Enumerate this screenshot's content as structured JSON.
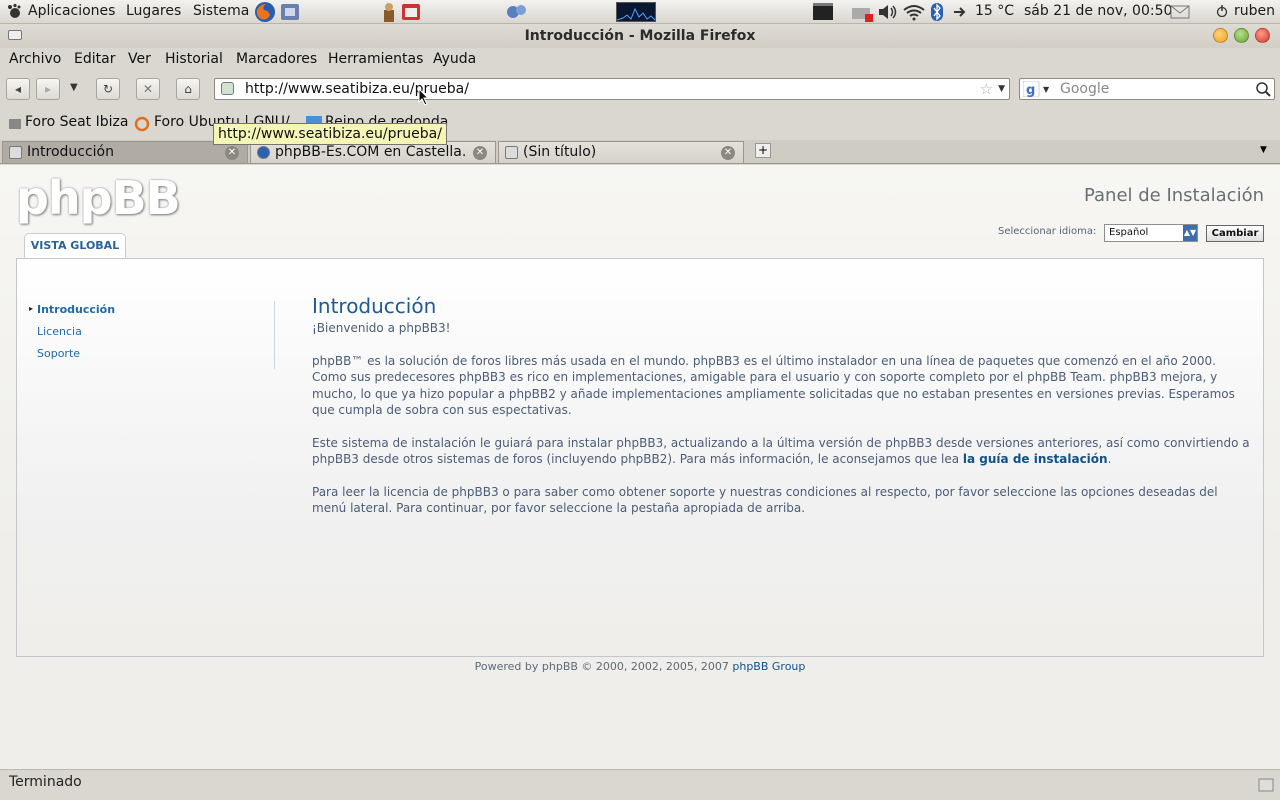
{
  "top_panel": {
    "applications": "Aplicaciones",
    "places": "Lugares",
    "system": "Sistema",
    "temperature": "15 °C",
    "datetime": "sáb 21 de nov, 00:50",
    "user": "ruben"
  },
  "window": {
    "title": "Introducción - Mozilla Firefox"
  },
  "menubar": [
    "Archivo",
    "Editar",
    "Ver",
    "Historial",
    "Marcadores",
    "Herramientas",
    "Ayuda"
  ],
  "navbar": {
    "url": "http://www.seatibiza.eu/prueba/",
    "search_placeholder": "Google"
  },
  "bookmarks": [
    "Foro Seat Ibiza",
    "Foro Ubuntu | GNU/",
    "Reino de redonda"
  ],
  "tooltip": "http://www.seatibiza.eu/prueba/",
  "tabs": [
    {
      "label": "Introducción",
      "active": true
    },
    {
      "label": "phpBB-Es.COM en Castella...",
      "active": false
    },
    {
      "label": "(Sin título)",
      "active": false
    }
  ],
  "page": {
    "logo": "phpBB",
    "panel_title": "Panel de Instalación",
    "lang_label": "Seleccionar idioma:",
    "lang_value": "Español",
    "change_button": "Cambiar",
    "tab_label": "VISTA GLOBAL",
    "sidenav": [
      "Introducción",
      "Licencia",
      "Soporte"
    ],
    "heading": "Introducción",
    "welcome": "¡Bienvenido a phpBB3!",
    "para1": "phpBB™ es la solución de foros libres más usada en el mundo. phpBB3 es el último instalador en una línea de paquetes que comenzó en el año 2000. Como sus predecesores phpBB3 es rico en implementaciones, amigable para el usuario y con soporte completo por el phpBB Team. phpBB3 mejora, y mucho, lo que ya hizo popular a phpBB2 y añade implementaciones ampliamente solicitadas que no estaban presentes en versiones previas. Esperamos que cumpla de sobra con sus espectativas.",
    "para2_before": "Este sistema de instalación le guiará para instalar phpBB3, actualizando a la última versión de phpBB3 desde versiones anteriores, así como convirtiendo a phpBB3 desde otros sistemas de foros (incluyendo phpBB2). Para más información, le aconsejamos que lea ",
    "para2_link": "la guía de instalación",
    "para2_after": ".",
    "para3": "Para leer la licencia de phpBB3 o para saber como obtener soporte y nuestras condiciones al respecto, por favor seleccione las opciones deseadas del menú lateral. Para continuar, por favor seleccione la pestaña apropiada de arriba.",
    "footer_text": "Powered by phpBB © 2000, 2002, 2005, 2007 ",
    "footer_link": "phpBB Group"
  },
  "status": "Terminado",
  "colors": {
    "link": "#105289",
    "heading": "#1e5a96",
    "body_text": "#4c5d77"
  }
}
